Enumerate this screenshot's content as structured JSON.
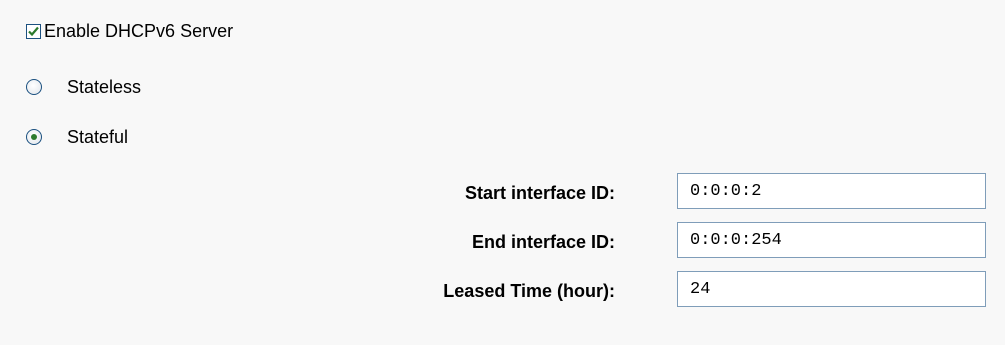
{
  "dhcp": {
    "enable_label": "Enable DHCPv6 Server",
    "enabled": true,
    "mode_options": [
      {
        "label": "Stateless",
        "selected": false
      },
      {
        "label": "Stateful",
        "selected": true
      }
    ]
  },
  "fields": {
    "start_id": {
      "label": "Start interface ID:",
      "value": "0:0:0:2"
    },
    "end_id": {
      "label": "End interface ID:",
      "value": "0:0:0:254"
    },
    "leased_time": {
      "label": "Leased Time (hour):",
      "value": "24"
    }
  },
  "colors": {
    "checkmark": "#2c7a2c",
    "control_border": "#1c5180",
    "input_border": "#7f9db9",
    "background": "#f8f8f8"
  }
}
